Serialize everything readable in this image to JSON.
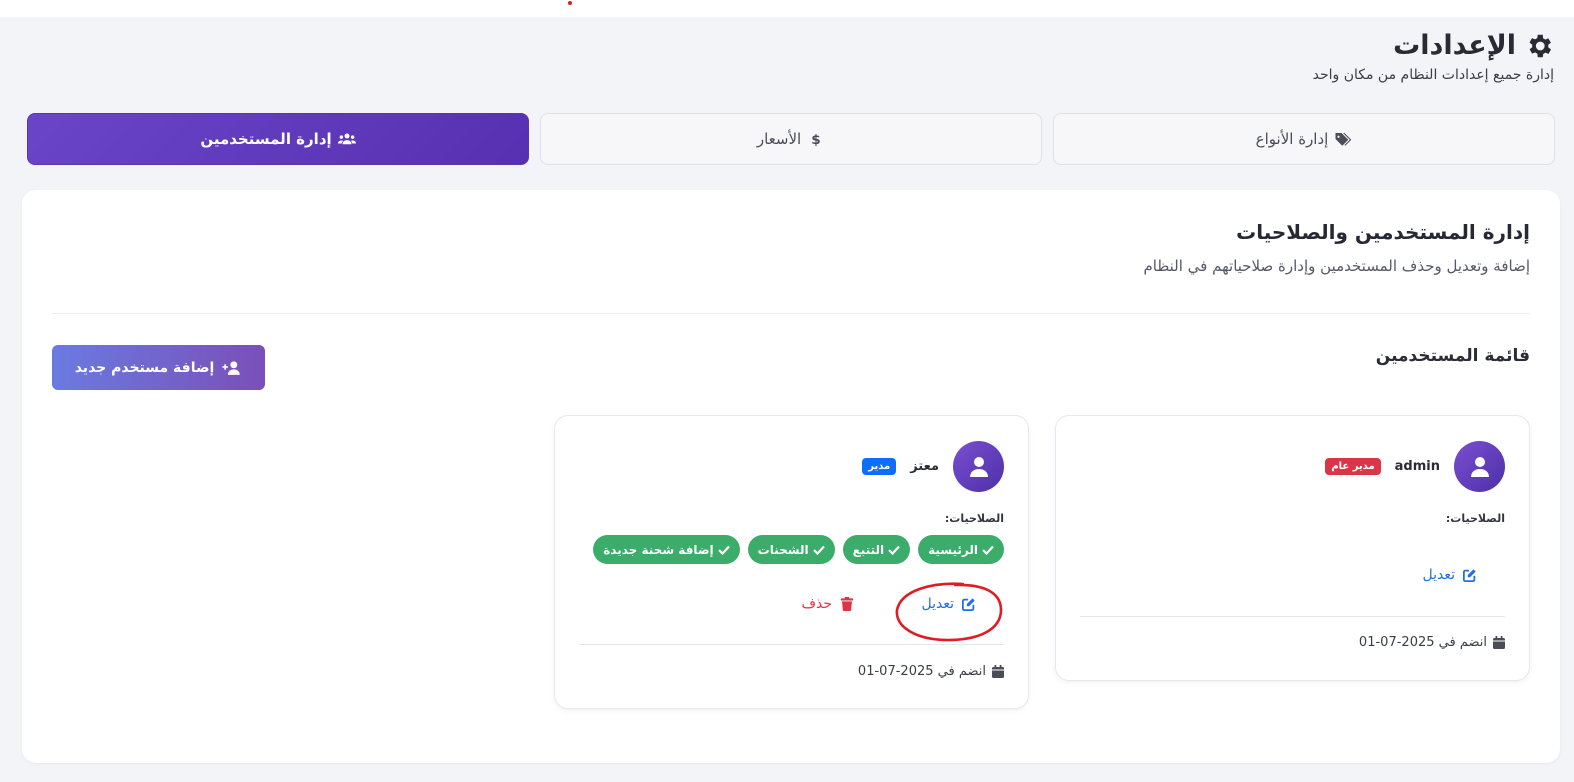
{
  "page": {
    "title": "الإعدادات",
    "subtitle": "إدارة جميع إعدادات النظام من مكان واحد"
  },
  "tabs": [
    {
      "label": "إدارة الأنواع",
      "icon": "tags-icon",
      "active": false
    },
    {
      "label": "الأسعار",
      "icon": "dollar-icon",
      "active": false
    },
    {
      "label": "إدارة المستخدمين",
      "icon": "users-icon",
      "active": true
    }
  ],
  "section": {
    "title": "إدارة المستخدمين والصلاحيات",
    "description": "إضافة وتعديل وحذف المستخدمين وإدارة صلاحياتهم في النظام",
    "list_title": "قائمة المستخدمين",
    "add_button": "إضافة مستخدم جديد"
  },
  "users": [
    {
      "name": "admin",
      "role_badge": "مدير عام",
      "badge_color": "#dc3545",
      "permissions_label": "الصلاحيات:",
      "permissions": [],
      "edit_label": "تعديل",
      "joined": "انضم في 2025-07-01"
    },
    {
      "name": "معتز",
      "role_badge": "مدير",
      "badge_color": "#0d6efd",
      "permissions_label": "الصلاحيات:",
      "permissions": [
        "الرئيسية",
        "التتبع",
        "الشحنات",
        "إضافة شحنة جديدة"
      ],
      "edit_label": "تعديل",
      "delete_label": "حذف",
      "joined": "انضم في 2025-07-01"
    }
  ],
  "colors": {
    "accent": "#5a34b4",
    "chip": "#3cac6a",
    "edit": "#1f6fe0",
    "delete": "#dc3545",
    "annotation": "#e01b24"
  }
}
